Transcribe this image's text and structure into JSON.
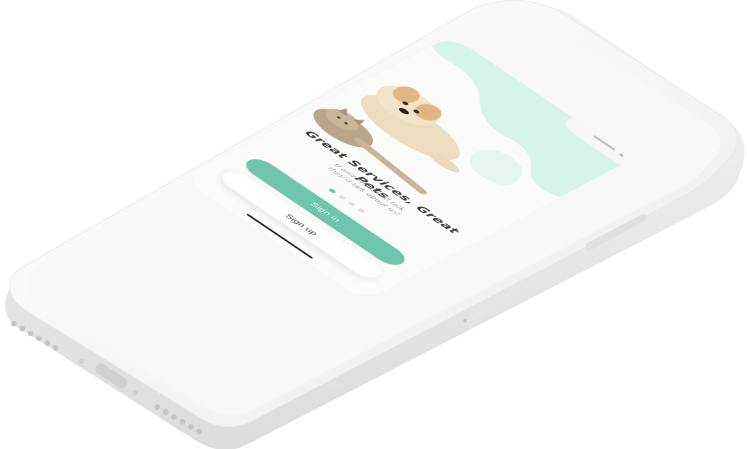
{
  "onboarding": {
    "title": "Great Services, Great Pets",
    "subtitle_line1": "If animals could talk,",
    "subtitle_line2": "they'd talk about us!",
    "page_count": 4,
    "active_page": 1
  },
  "actions": {
    "signin_label": "Sign in",
    "signup_label": "Sign up"
  },
  "colors": {
    "accent": "#6dc6ac",
    "mint_background": "#d7f4e8",
    "screen_background": "#fbfcfa",
    "title_text": "#3a3a3c",
    "subtitle_text": "#9a9a9a"
  },
  "icons": [
    "dog-photo",
    "cat-photo",
    "phone-speaker",
    "front-camera",
    "charging-port",
    "speaker-grill"
  ]
}
